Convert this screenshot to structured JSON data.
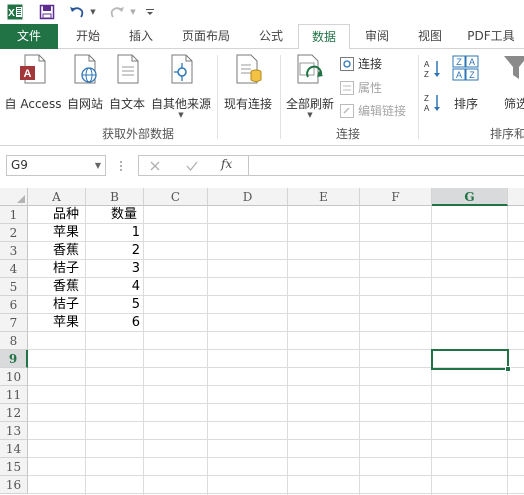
{
  "qat": {
    "excel_icon": "excel-logo-icon",
    "save_icon": "save-icon",
    "undo_icon": "undo-icon",
    "redo_icon": "redo-icon",
    "customize_icon": "customize-qat-icon"
  },
  "tabs": [
    "文件",
    "开始",
    "插入",
    "页面布局",
    "公式",
    "数据",
    "审阅",
    "视图",
    "PDF工具"
  ],
  "active_tab": "数据",
  "ribbon": {
    "get_external": {
      "from_access": "自 Access",
      "from_web": "自网站",
      "from_text": "自文本",
      "from_other": "自其他来源",
      "group_label": "获取外部数据"
    },
    "existing_connections": "现有连接",
    "connections": {
      "refresh_all": "全部刷新",
      "connections": "连接",
      "properties": "属性",
      "edit_links": "编辑链接",
      "group_label": "连接"
    },
    "sort_filter": {
      "sort": "排序",
      "filter": "筛选",
      "group_label": "排序和"
    }
  },
  "formula_bar": {
    "name_box": "G9",
    "cancel_icon": "cancel-icon",
    "enter_icon": "enter-icon",
    "fx_label": "fx",
    "formula": ""
  },
  "columns": [
    "A",
    "B",
    "C",
    "D",
    "E",
    "F",
    "G"
  ],
  "selected_column": "G",
  "rows": [
    "1",
    "2",
    "3",
    "4",
    "5",
    "6",
    "7",
    "8",
    "9",
    "10",
    "11",
    "12",
    "13",
    "14",
    "15",
    "16"
  ],
  "selected_row": "9",
  "sheet": {
    "header": {
      "a": "品种",
      "b": "数量"
    },
    "data": [
      {
        "a": "苹果",
        "b": "1"
      },
      {
        "a": "香蕉",
        "b": "2"
      },
      {
        "a": "桔子",
        "b": "3"
      },
      {
        "a": "香蕉",
        "b": "4"
      },
      {
        "a": "桔子",
        "b": "5"
      },
      {
        "a": "苹果",
        "b": "6"
      }
    ]
  },
  "colors": {
    "excel_green": "#217346",
    "header_bg": "#f3f3f3",
    "gridline": "#dadcdd"
  }
}
